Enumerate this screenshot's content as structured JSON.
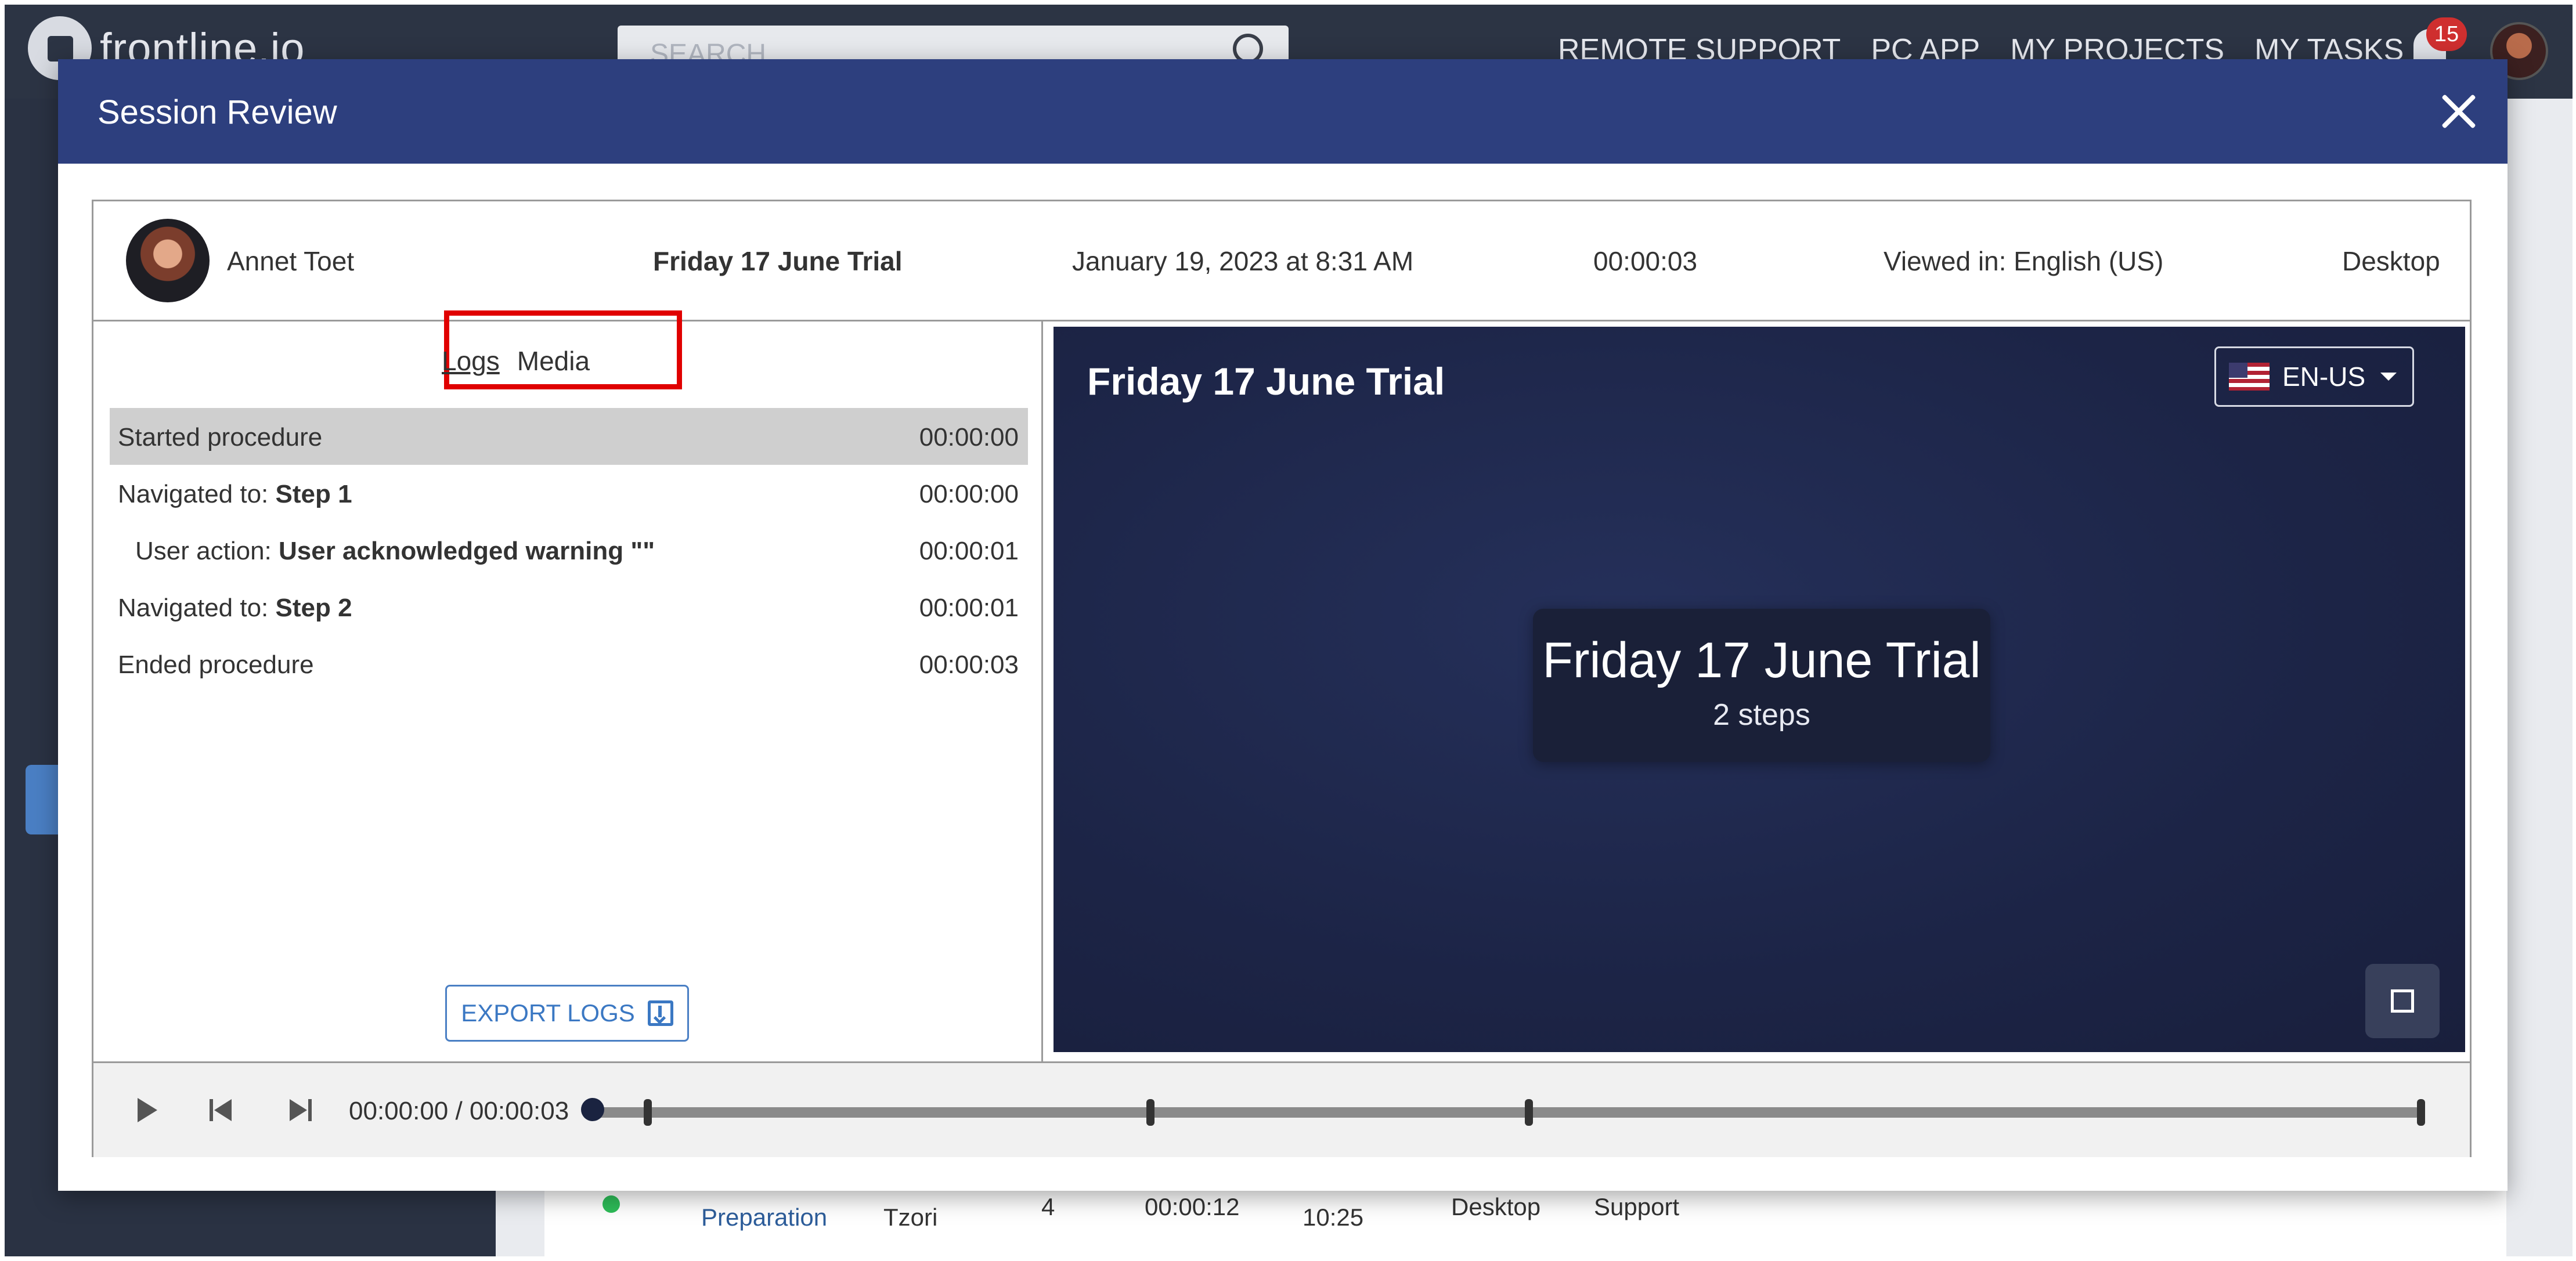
{
  "app": {
    "brand": "frontline.io",
    "search_placeholder": "SEARCH",
    "nav": [
      "REMOTE SUPPORT",
      "PC APP",
      "MY PROJECTS",
      "MY TASKS"
    ],
    "notification_count": "15",
    "background_row": {
      "name": "Preparation",
      "user": "Tzori",
      "count": "4",
      "duration": "00:00:12",
      "time": "10:25",
      "device": "Desktop",
      "type": "Support"
    }
  },
  "modal": {
    "title": "Session Review",
    "session": {
      "user": "Annet Toet",
      "procedure": "Friday 17 June Trial",
      "date": "January 19, 2023 at 8:31 AM",
      "duration": "00:00:03",
      "viewed_in": "Viewed in: English (US)",
      "device": "Desktop"
    },
    "tabs": {
      "logs": "Logs",
      "media": "Media"
    },
    "logs": [
      {
        "text": "Started procedure",
        "time": "00:00:00",
        "selected": true
      },
      {
        "prefix": "Navigated to: ",
        "bold": "Step 1",
        "time": "00:00:00"
      },
      {
        "prefix": "User action: ",
        "bold": "User acknowledged warning \"\"",
        "time": "00:00:01",
        "indent": true
      },
      {
        "prefix": "Navigated to: ",
        "bold": "Step 2",
        "time": "00:00:01"
      },
      {
        "text": "Ended procedure",
        "time": "00:00:03"
      }
    ],
    "export_label": "EXPORT LOGS",
    "viewer": {
      "title": "Friday 17 June Trial",
      "language": "EN-US",
      "card_title": "Friday 17 June Trial",
      "card_subtitle": "2 steps"
    },
    "player": {
      "time": "00:00:00 / 00:00:03",
      "progress": 0,
      "markers": [
        0.03,
        0.305,
        0.512,
        1.0
      ]
    },
    "colors": {
      "header": "#2d3f7e",
      "highlight": "#e00000",
      "accent": "#3b78c3"
    }
  }
}
